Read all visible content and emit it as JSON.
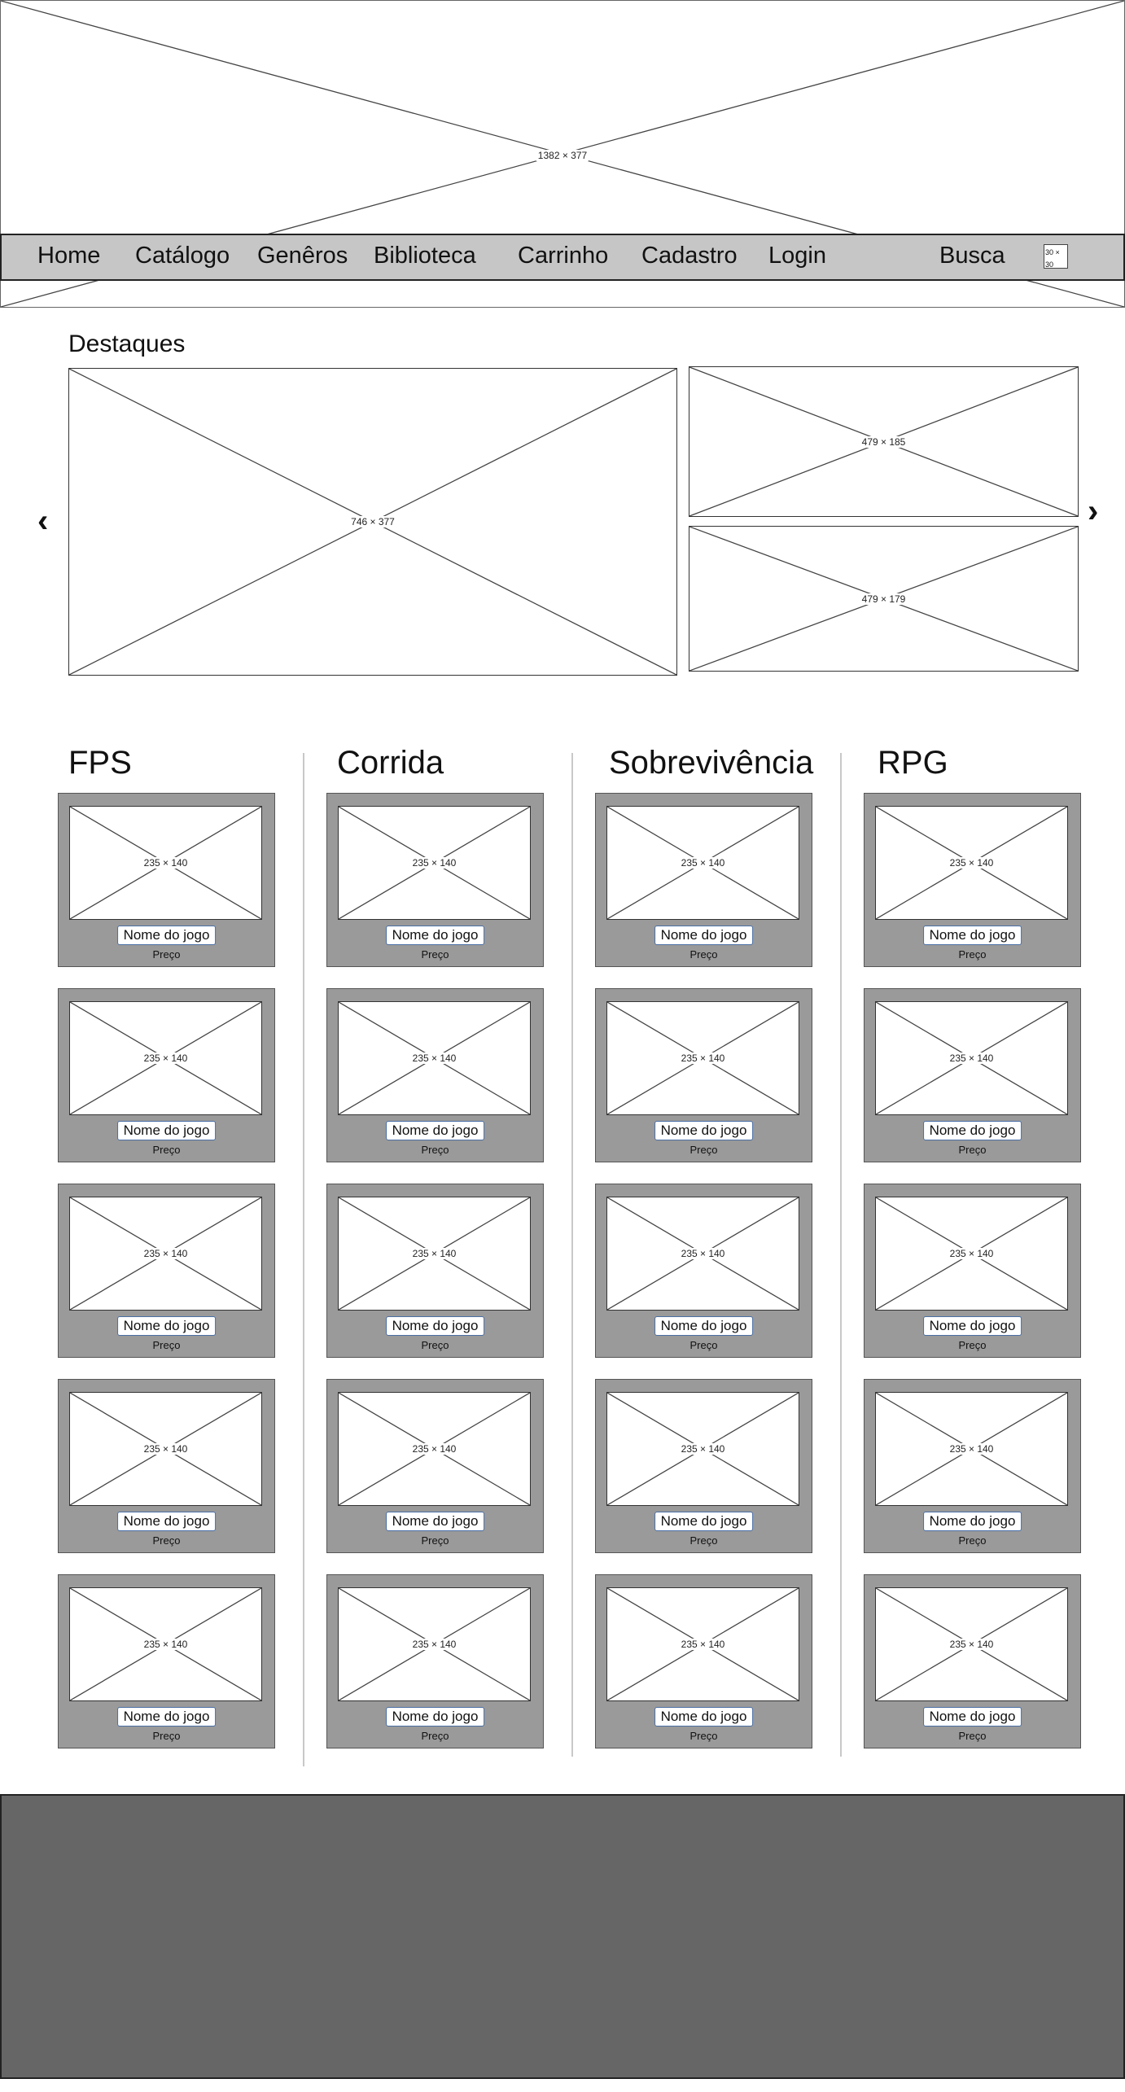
{
  "banner": {
    "placeholder": "1382 × 377"
  },
  "nav": {
    "items": [
      "Home",
      "Catálogo",
      "Genêros",
      "Biblioteca",
      "Carrinho",
      "Cadastro",
      "Login"
    ],
    "search_label": "Busca",
    "cart_icon": {
      "icon": "cart-icon",
      "placeholder": "30 × 30"
    }
  },
  "featured": {
    "title": "Destaques",
    "main_placeholder": "746 × 377",
    "side_top_placeholder": "479 × 185",
    "side_bottom_placeholder": "479 × 179",
    "prev_arrow": "‹",
    "next_arrow": "›"
  },
  "genres": [
    {
      "title": "FPS"
    },
    {
      "title": "Corrida"
    },
    {
      "title": "Sobrevivência"
    },
    {
      "title": "RPG"
    }
  ],
  "card": {
    "image_placeholder": "235 × 140",
    "name_label": "Nome do jogo",
    "price_label": "Preço"
  },
  "colors": {
    "nav_bg": "#c6c6c6",
    "card_bg": "#9a9a9a",
    "footer_bg": "#666666"
  }
}
